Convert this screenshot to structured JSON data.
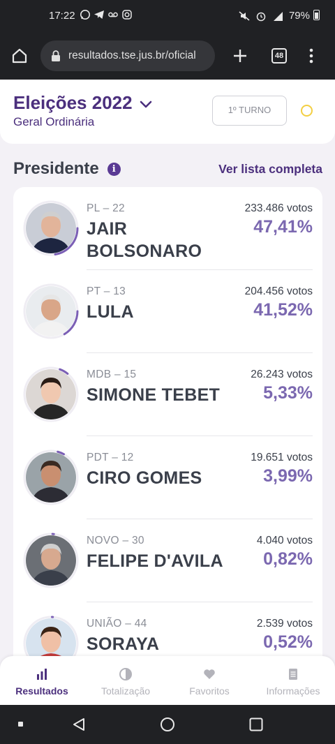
{
  "status_bar": {
    "time": "17:22",
    "battery": "79%",
    "left_icons": [
      "whatsapp-icon",
      "telegram-icon",
      "voicemail-icon",
      "instagram-icon"
    ],
    "right_icons": [
      "mute-icon",
      "alarm-icon",
      "signal-icon",
      "battery-icon"
    ]
  },
  "browser": {
    "url": "resultados.tse.jus.br/oficial",
    "tab_count": "48"
  },
  "header": {
    "title": "Eleições 2022",
    "subtitle": "Geral Ordinária",
    "turno_label": "1º TURNO"
  },
  "section": {
    "title": "Presidente",
    "see_all_label": "Ver lista completa"
  },
  "candidates": [
    {
      "party": "PL – 22",
      "name_line1": "JAIR",
      "name_line2": "BOLSONARO",
      "votes": "233.486 votos",
      "percent": "47,41%",
      "share": 0.4741
    },
    {
      "party": "PT – 13",
      "name_line1": "LULA",
      "name_line2": "",
      "votes": "204.456 votos",
      "percent": "41,52%",
      "share": 0.4152
    },
    {
      "party": "MDB – 15",
      "name_line1": "SIMONE TEBET",
      "name_line2": "",
      "votes": "26.243 votos",
      "percent": "5,33%",
      "share": 0.0533
    },
    {
      "party": "PDT – 12",
      "name_line1": "CIRO GOMES",
      "name_line2": "",
      "votes": "19.651 votos",
      "percent": "3,99%",
      "share": 0.0399
    },
    {
      "party": "NOVO – 30",
      "name_line1": "FELIPE D'AVILA",
      "name_line2": "",
      "votes": "4.040 votos",
      "percent": "0,82%",
      "share": 0.0082
    },
    {
      "party": "UNIÃO – 44",
      "name_line1": "SORAYA",
      "name_line2": "",
      "votes": "2.539 votos",
      "percent": "0,52%",
      "share": 0.0052
    }
  ],
  "bottom_nav": {
    "items": [
      "Resultados",
      "Totalização",
      "Favoritos",
      "Informações"
    ],
    "active": "Resultados"
  },
  "colors": {
    "brand_purple": "#4b2f7d",
    "percent_purple": "#7b68b0",
    "ring_purple": "#7b5fb5",
    "status_yellow": "#f3cf43"
  }
}
